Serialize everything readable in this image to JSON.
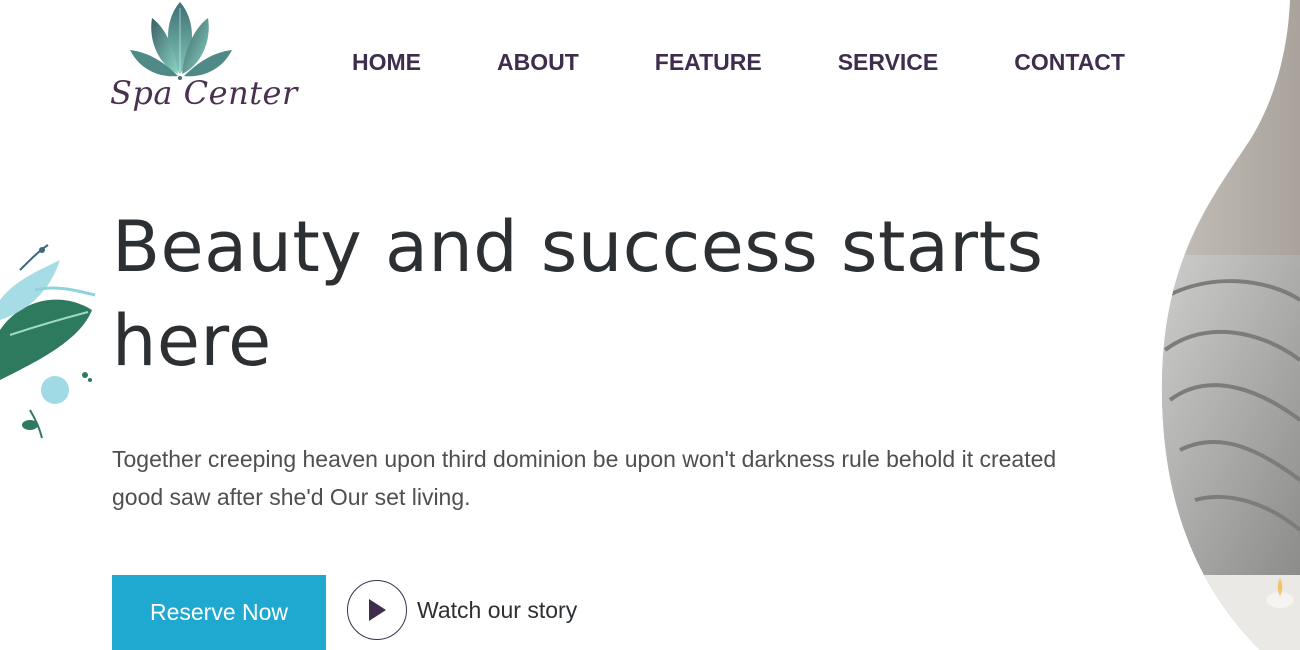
{
  "logo": {
    "text": "Spa Center",
    "icon": "lotus-leaf-logo"
  },
  "nav": {
    "items": [
      {
        "label": "HOME"
      },
      {
        "label": "ABOUT"
      },
      {
        "label": "FEATURE"
      },
      {
        "label": "SERVICE"
      },
      {
        "label": "CONTACT"
      }
    ]
  },
  "hero": {
    "title": "Beauty and success starts here",
    "description": "Together creeping heaven upon third dominion be upon won't darkness rule behold it created good saw after she'd Our set living.",
    "reserve_label": "Reserve Now",
    "watch_label": "Watch our story",
    "play_icon": "play-icon"
  },
  "colors": {
    "nav_text": "#3f2d4d",
    "title_text": "#2d3033",
    "body_text": "#4f4f4f",
    "accent": "#1fa9d1",
    "leaf_dark": "#2e7a5e",
    "leaf_light": "#8fd3df"
  }
}
